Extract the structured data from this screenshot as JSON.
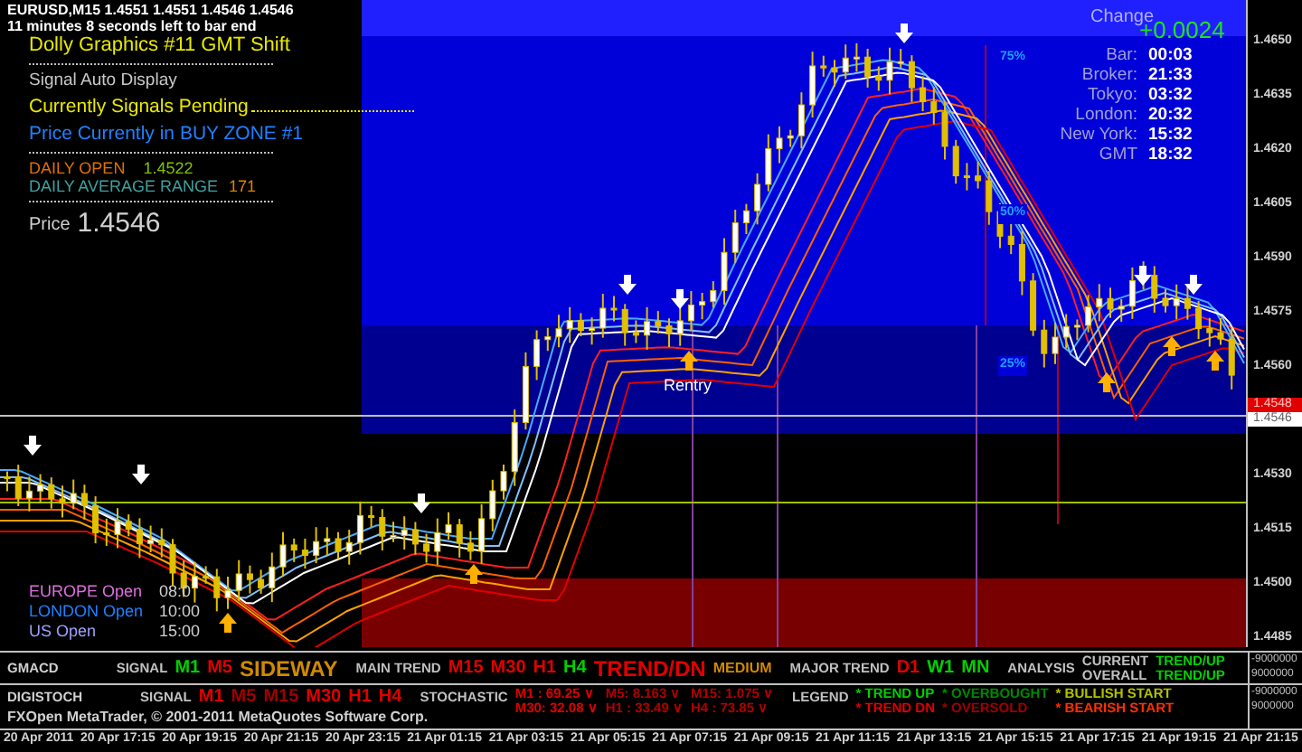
{
  "chart_header": {
    "symbol_line": "EURUSD,M15  1.4551 1.4551 1.4546 1.4546",
    "timer": "11 minutes 8 seconds left to bar end"
  },
  "info_panel": {
    "title": "Dolly Graphics #11 GMT Shift",
    "mode": "Signal Auto Display",
    "signal_status": "Currently Signals Pending",
    "zone": "Price Currently in BUY ZONE #1",
    "daily_open": {
      "label": "DAILY OPEN",
      "value": "1.4522"
    },
    "daily_range": {
      "label": "DAILY AVERAGE RANGE",
      "value": "171"
    },
    "price": {
      "label": "Price",
      "value": "1.4546"
    }
  },
  "clock_panel": {
    "change_label": "Change",
    "change_value": "+0.0024",
    "rows": [
      {
        "label": "Bar:",
        "value": "00:03"
      },
      {
        "label": "Broker:",
        "value": "21:33"
      },
      {
        "label": "Tokyo:",
        "value": "03:32"
      },
      {
        "label": "London:",
        "value": "20:32"
      },
      {
        "label": "New York:",
        "value": "15:32"
      },
      {
        "label": "GMT",
        "value": "18:32"
      }
    ]
  },
  "zone_levels": [
    "75%",
    "50%",
    "25%"
  ],
  "reentry_label": "Rentry",
  "sessions": [
    {
      "label": "EUROPE Open",
      "time": "08:0",
      "color": "#e070e0"
    },
    {
      "label": "LONDON Open",
      "time": "10:00",
      "color": "#2080ff"
    },
    {
      "label": "US Open",
      "time": "15:00",
      "color": "#a0a0ff"
    }
  ],
  "price_axis": {
    "ticks": [
      "1.4650",
      "1.4635",
      "1.4620",
      "1.4605",
      "1.4590",
      "1.4575",
      "1.4560",
      "1.4530",
      "1.4515",
      "1.4500",
      "1.4485"
    ],
    "bid": "1.4548",
    "current": "1.4546"
  },
  "gmacd": {
    "segments": [
      {
        "kind": "title",
        "text": "GMACD"
      },
      {
        "kind": "label",
        "text": "SIGNAL"
      },
      {
        "kind": "tf",
        "text": "M1",
        "color": "#00d000"
      },
      {
        "kind": "tf",
        "text": "M5",
        "color": "#e00000"
      },
      {
        "kind": "status",
        "text": "SIDEWAY",
        "color": "#d08a00"
      },
      {
        "kind": "label",
        "text": "MAIN TREND"
      },
      {
        "kind": "tf",
        "text": "M15",
        "color": "#e00000"
      },
      {
        "kind": "tf",
        "text": "M30",
        "color": "#e00000"
      },
      {
        "kind": "tf",
        "text": "H1",
        "color": "#e00000"
      },
      {
        "kind": "tf",
        "text": "H4",
        "color": "#00d000"
      },
      {
        "kind": "status",
        "text": "TREND/DN",
        "color": "#e00000"
      },
      {
        "kind": "small",
        "text": "MEDIUM",
        "color": "#d08a00"
      },
      {
        "kind": "label",
        "text": "MAJOR TREND"
      },
      {
        "kind": "tf",
        "text": "D1",
        "color": "#e00000"
      },
      {
        "kind": "tf",
        "text": "W1",
        "color": "#00d000"
      },
      {
        "kind": "tf",
        "text": "MN",
        "color": "#00d000"
      },
      {
        "kind": "label",
        "text": "ANALYSIS"
      },
      {
        "kind": "stack",
        "lines": [
          "CURRENT",
          "OVERALL"
        ],
        "color": "#c0c0c0"
      },
      {
        "kind": "stack",
        "lines": [
          "TREND/UP",
          "TREND/UP"
        ],
        "color": "#00d000"
      }
    ],
    "scale": [
      "-9000000",
      "9000000"
    ]
  },
  "digistoch": {
    "segments": [
      {
        "kind": "title",
        "text": "DIGISTOCH"
      },
      {
        "kind": "label",
        "text": "SIGNAL"
      },
      {
        "kind": "tf",
        "text": "M1",
        "color": "#e00000"
      },
      {
        "kind": "tf",
        "text": "M5",
        "color": "#a00000"
      },
      {
        "kind": "tf",
        "text": "M15",
        "color": "#a00000"
      },
      {
        "kind": "tf",
        "text": "M30",
        "color": "#e00000"
      },
      {
        "kind": "tf",
        "text": "H1",
        "color": "#e00000"
      },
      {
        "kind": "tf",
        "text": "H4",
        "color": "#e00000"
      },
      {
        "kind": "label",
        "text": "STOCHASTIC"
      },
      {
        "kind": "stack",
        "lines": [
          "M1 : 69.25 ∨",
          "M30: 32.08 ∨"
        ],
        "color": "#e00000"
      },
      {
        "kind": "stack",
        "lines": [
          "M5: 8.163 ∨",
          "H1 : 33.49 ∨"
        ],
        "color": "#b00000"
      },
      {
        "kind": "stack",
        "lines": [
          "M15: 1.075 ∨",
          "H4 : 73.85 ∨"
        ],
        "color": "#b00000"
      },
      {
        "kind": "label",
        "text": "LEGEND"
      },
      {
        "kind": "legend",
        "items": [
          {
            "text": "* TREND UP",
            "color": "#00d000"
          },
          {
            "text": "* TREND DN",
            "color": "#e00000"
          }
        ]
      },
      {
        "kind": "legend",
        "items": [
          {
            "text": "* OVERBOUGHT",
            "color": "#008800"
          },
          {
            "text": "* OVERSOLD",
            "color": "#a00000"
          }
        ]
      },
      {
        "kind": "legend",
        "items": [
          {
            "text": "* BULLISH START",
            "color": "#b0c000"
          },
          {
            "text": "* BEARISH START",
            "color": "#ff3000"
          }
        ]
      }
    ],
    "scale": [
      "-9000000",
      "9000000"
    ]
  },
  "copyright": "FXOpen MetaTrader, © 2001-2011 MetaQuotes Software Corp.",
  "time_axis": [
    "20 Apr 2011",
    "20 Apr 17:15",
    "20 Apr 19:15",
    "20 Apr 21:15",
    "20 Apr 23:15",
    "21 Apr 01:15",
    "21 Apr 03:15",
    "21 Apr 05:15",
    "21 Apr 07:15",
    "21 Apr 09:15",
    "21 Apr 11:15",
    "21 Apr 13:15",
    "21 Apr 15:15",
    "21 Apr 17:15",
    "21 Apr 19:15",
    "21 Apr 21:15"
  ]
}
